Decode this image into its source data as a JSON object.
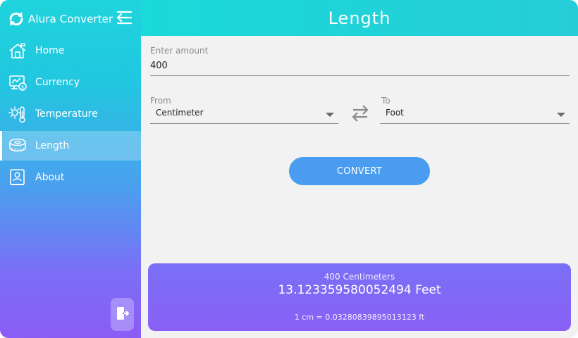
{
  "app": {
    "name": "Alura Converter"
  },
  "header": {
    "title": "Length"
  },
  "sidebar": {
    "items": [
      {
        "label": "Home",
        "icon": "home-icon"
      },
      {
        "label": "Currency",
        "icon": "currency-chart-icon"
      },
      {
        "label": "Temperature",
        "icon": "temperature-icon"
      },
      {
        "label": "Length",
        "icon": "measuring-tape-icon",
        "active": true
      },
      {
        "label": "About",
        "icon": "about-user-icon"
      }
    ]
  },
  "form": {
    "amount_label": "Enter amount",
    "amount_value": "400",
    "from_label": "From",
    "from_value": "Centimeter",
    "to_label": "To",
    "to_value": "Foot",
    "convert_label": "CONVERT"
  },
  "result": {
    "input_text": "400 Centimeters",
    "output_text": "13.123359580052494 Feet",
    "rate_text": "1 cm = 0.03280839895013123 ft"
  },
  "colors": {
    "header": "#1ad9d9",
    "accent": "#4a9cf0",
    "result_card": "#7a6ff6",
    "sidebar_top": "#1fd4dc",
    "sidebar_bottom": "#8b5cf6"
  }
}
